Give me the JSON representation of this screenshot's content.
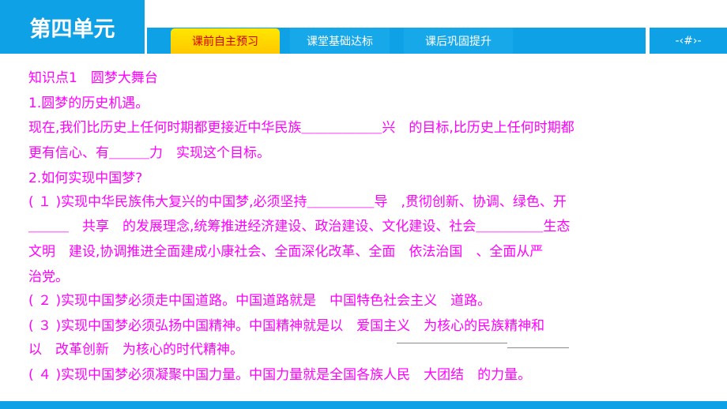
{
  "header": {
    "unit_title": "第四单元",
    "tabs": [
      {
        "label": "课前自主预习",
        "active": true
      },
      {
        "label": "课堂基础达标",
        "active": false
      },
      {
        "label": "课后巩固提升",
        "active": false
      }
    ],
    "page_indicator": "-‹#›-"
  },
  "content": {
    "lines": [
      "知识点1　圆梦大舞台",
      "1.圆梦的历史机遇。",
      "现在,我们比历史上任何时期都更接近中华民族＿＿＿＿＿＿兴　的目标,比历史上任何时期都",
      "更有信心、有＿＿＿力　实现这个目标。",
      "2.如何实现中国梦?",
      "( １ )实现中华民族伟大复兴的中国梦,必须坚持＿＿＿＿＿导　,贯彻创新、协调、绿色、开",
      "＿＿＿　共享　的发展理念,统筹推进经济建设、政治建设、文化建设、社会＿＿＿＿＿生态",
      "文明　建设,协调推进全面建成小康社会、全面深化改革、全面　依法治国　、全面从严",
      "治党。",
      "( ２ )实现中国梦必须走中国道路。中国道路就是　中国特色社会主义　道路。",
      "( ３ )实现中国梦必须弘扬中国精神。中国精神就是以　爱国主义　为核心的民族精神和",
      "以　改革创新　为核心的时代精神。",
      "( ４ )实现中国梦必须凝聚中国力量。中国力量就是全国各族人民　大团结　的力量。"
    ]
  },
  "colors": {
    "brand_blue": "#0ea1e6",
    "active_tab": "#ffd400",
    "active_tab_text": "#d40000",
    "body_text": "#ff00ff"
  }
}
